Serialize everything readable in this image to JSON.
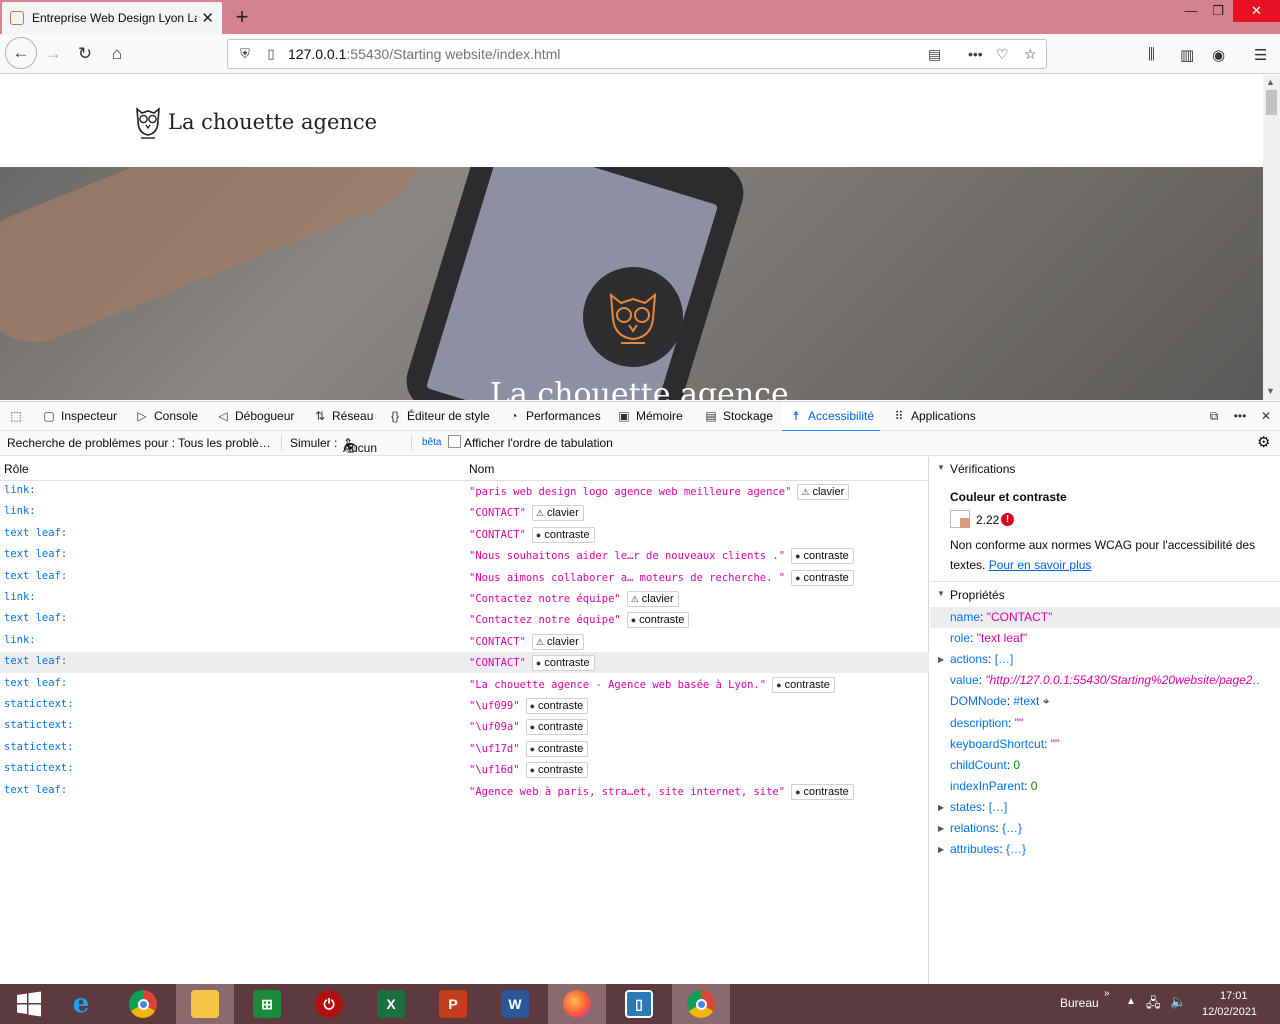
{
  "browser": {
    "tab_title": "Entreprise Web Design Lyon La",
    "url_host": "127.0.0.1",
    "url_rest": ":55430/Starting website/index.html"
  },
  "page": {
    "brand_name": "La chouette agence",
    "hero_text": "La chouette agence"
  },
  "devtools": {
    "tabs": [
      {
        "label": "Inspecteur",
        "icon": "inspector-icon"
      },
      {
        "label": "Console",
        "icon": "console-icon"
      },
      {
        "label": "Débogueur",
        "icon": "debugger-icon"
      },
      {
        "label": "Réseau",
        "icon": "network-icon"
      },
      {
        "label": "Éditeur de style",
        "icon": "style-editor-icon"
      },
      {
        "label": "Performances",
        "icon": "performance-icon"
      },
      {
        "label": "Mémoire",
        "icon": "memory-icon"
      },
      {
        "label": "Stockage",
        "icon": "storage-icon"
      },
      {
        "label": "Accessibilité",
        "icon": "accessibility-icon"
      },
      {
        "label": "Applications",
        "icon": "applications-icon"
      }
    ],
    "toolbar": {
      "search_label": "Recherche de problèmes pour :",
      "search_value": "Tous les problè…",
      "simulate_label": "Simuler :",
      "simulate_value": "Aucun",
      "beta": "bêta",
      "tab_order": "Afficher l'ordre de tabulation"
    },
    "tree": {
      "col_role": "Rôle",
      "col_name": "Nom",
      "rows": [
        {
          "role": "link:",
          "name": "\"paris web design logo agence web meilleure agence\"",
          "badge": "clavier"
        },
        {
          "role": "link:",
          "name": "\"CONTACT\"",
          "badge": "clavier"
        },
        {
          "role": "text leaf:",
          "name": "\"CONTACT\"",
          "badge": "contraste"
        },
        {
          "role": "text leaf:",
          "name": "\"Nous souhaitons aider le…r de nouveaux clients .\"",
          "badge": "contraste"
        },
        {
          "role": "text leaf:",
          "name": "\"Nous aimons collaborer a… moteurs de recherche. \"",
          "badge": "contraste"
        },
        {
          "role": "link:",
          "name": "\"Contactez notre équipe\"",
          "badge": "clavier"
        },
        {
          "role": "text leaf:",
          "name": "\"Contactez notre équipe\"",
          "badge": "contraste"
        },
        {
          "role": "link:",
          "name": "\"CONTACT\"",
          "badge": "clavier"
        },
        {
          "role": "text leaf:",
          "name": "\"CONTACT\"",
          "badge": "contraste"
        },
        {
          "role": "text leaf:",
          "name": "\"La chouette agence - Agence web basée à Lyon.\"",
          "badge": "contraste"
        },
        {
          "role": "statictext:",
          "name": "\"\\uf099\"",
          "badge": "contraste"
        },
        {
          "role": "statictext:",
          "name": "\"\\uf09a\"",
          "badge": "contraste"
        },
        {
          "role": "statictext:",
          "name": "\"\\uf17d\"",
          "badge": "contraste"
        },
        {
          "role": "statictext:",
          "name": "\"\\uf16d\"",
          "badge": "contraste"
        },
        {
          "role": "text leaf:",
          "name": "\"Agence web à paris, stra…et, site internet, site\"",
          "badge": "contraste"
        }
      ],
      "selected_row": 8
    },
    "side": {
      "checks_title": "Vérifications",
      "contrast_title": "Couleur et contraste",
      "contrast_ratio": "2.22",
      "contrast_message": "Non conforme aux normes WCAG pour l'accessibilité des textes.",
      "learn_more": "Pour en savoir plus",
      "props_title": "Propriétés",
      "props": [
        {
          "key": "name",
          "val": "\"CONTACT\"",
          "kind": "str",
          "expand": false
        },
        {
          "key": "role",
          "val": "\"text leaf\"",
          "kind": "str",
          "expand": false
        },
        {
          "key": "actions",
          "val": "[…]",
          "kind": "obj",
          "expand": true
        },
        {
          "key": "value",
          "val": "\"http://127.0.0.1:55430/Starting%20website/page2…",
          "kind": "ital",
          "expand": false
        },
        {
          "key": "DOMNode",
          "val": "#text",
          "kind": "obj",
          "expand": false
        },
        {
          "key": "description",
          "val": "\"\"",
          "kind": "str",
          "expand": false
        },
        {
          "key": "keyboardShortcut",
          "val": "\"\"",
          "kind": "str",
          "expand": false
        },
        {
          "key": "childCount",
          "val": "0",
          "kind": "num",
          "expand": false
        },
        {
          "key": "indexInParent",
          "val": "0",
          "kind": "num",
          "expand": false
        },
        {
          "key": "states",
          "val": "[…]",
          "kind": "obj",
          "expand": true
        },
        {
          "key": "relations",
          "val": "{…}",
          "kind": "obj",
          "expand": true
        },
        {
          "key": "attributes",
          "val": "{…}",
          "kind": "obj",
          "expand": true
        }
      ]
    }
  },
  "taskbar": {
    "apps": [
      "start",
      "ie",
      "chrome",
      "explorer",
      "store",
      "power",
      "excel",
      "powerpoint",
      "word",
      "firefox",
      "app",
      "chrome2"
    ],
    "bureau": "Bureau",
    "time": "17:01",
    "date": "12/02/2021"
  }
}
